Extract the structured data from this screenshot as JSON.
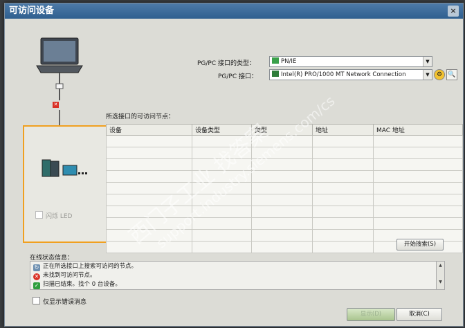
{
  "window": {
    "title": "可访问设备",
    "close": "×"
  },
  "interface": {
    "type_label": "PG/PC 接口的类型：",
    "type_value": "PN/IE",
    "iface_label": "PG/PC 接口：",
    "iface_value": "Intel(R) PRO/1000 MT Network Connection"
  },
  "nodes": {
    "title": "所选接口的可访问节点：",
    "columns": [
      "设备",
      "设备类型",
      "类型",
      "地址",
      "MAC 地址"
    ],
    "row_count": 10
  },
  "flash_led": {
    "label": "闪烁 LED"
  },
  "start_search": "开始搜索(S)",
  "status": {
    "title": "在线状态信息：",
    "rows": [
      {
        "icon": "search-progress-icon",
        "text": "正在所选接口上搜索可访问的节点。"
      },
      {
        "icon": "error-icon",
        "text": "未找到可访问节点。"
      },
      {
        "icon": "ok-icon",
        "text": "扫描已结束。找个 0 台设备。"
      }
    ],
    "show_errors": "仅显示错误消息"
  },
  "footer": {
    "connect": "显示(D)",
    "cancel": "取消(C)"
  },
  "watermark": {
    "line1": "西门子工业",
    "line1b": "找答案",
    "line2": "support.industry.siemens.com/cs"
  },
  "colors": {
    "panel_border": "#f0a020",
    "title_bar": "#2f5f8f",
    "error": "#d93025",
    "ok": "#2e9e3e"
  }
}
